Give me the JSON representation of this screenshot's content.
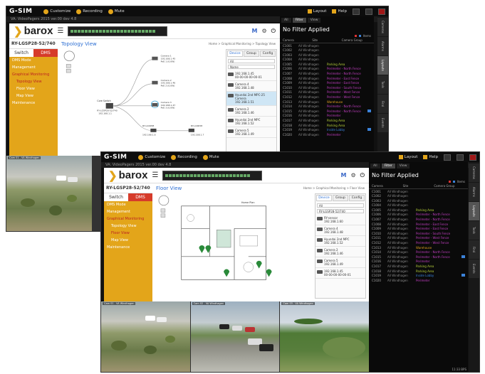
{
  "app": {
    "name": "G-SIM",
    "menu": [
      "Customize",
      "Recording",
      "Mute"
    ],
    "right_menu": [
      "Layout",
      "Help"
    ],
    "sub_label": "VA: VideoPagers 2015 ver.00 dev 4.8"
  },
  "brand": {
    "name": "barox"
  },
  "device": {
    "model": "RY-LGSP28-52/740"
  },
  "sidebar": {
    "tabs": [
      "Switch",
      "DMS"
    ],
    "items": [
      {
        "label": "DMS Mode"
      },
      {
        "label": "Management"
      },
      {
        "label": "Graphical Monitoring"
      },
      {
        "label": "Topology View"
      },
      {
        "label": "Floor View"
      },
      {
        "label": "Map View"
      },
      {
        "label": "Maintenance"
      }
    ]
  },
  "views": {
    "back": {
      "title": "Topology View",
      "crumb": "Home > Graphical Monitoring > Topology View"
    },
    "front": {
      "title": "Floor View",
      "crumb": "Home > Graphical Monitoring > Floor View",
      "floor_label": "Home Plan"
    }
  },
  "topology": {
    "core": {
      "label": "Core Switch",
      "model": "RY-LGSP28-52/740",
      "ip": "192.168.1.1"
    },
    "nodes": [
      {
        "name": "Camera 1",
        "ip": "192.168.1.45",
        "port": "PoE 1 (0.0W)"
      },
      {
        "name": "Camera 2",
        "ip": "192.168.1.46",
        "port": "PoE 2 (0.0W)"
      },
      {
        "name": "Camera 3",
        "ip": "192.168.1.47",
        "port": "PoE 3 (0.0W)"
      }
    ],
    "sw2": {
      "name": "RY-LGSP28",
      "ip": "192.168.1.6"
    },
    "sw3": {
      "name": "RY-LGSP28",
      "ip": "192.168.1.7"
    }
  },
  "device_panel": {
    "tabs": [
      "Device",
      "Group",
      "Config"
    ],
    "filter": "All",
    "select": "Name",
    "entries": [
      {
        "title": "192.168.1.45",
        "sub": "00-00-00-00-00-01"
      },
      {
        "title": "Camera 4",
        "sub": "192.168.1.48"
      },
      {
        "title": "Hyundai 2nd MPC-25 Camera",
        "sub": "192.168.1.51"
      },
      {
        "title": "Camera 2",
        "sub": "192.168.1.46"
      },
      {
        "title": "Hyundai 2nd MPC",
        "sub": "192.168.1.52"
      },
      {
        "title": "Camera 5",
        "sub": "192.168.1.49"
      },
      {
        "title": "RY-sensor",
        "sub": "192.168.1.60"
      }
    ]
  },
  "filter_panel": {
    "tabs": [
      "All",
      "Filter",
      "View"
    ],
    "title": "No Filter Applied",
    "count_label": "Items",
    "columns": [
      "Camera",
      "Site",
      "Camera Group"
    ],
    "rows": [
      {
        "id": "C1001",
        "site": "All Windhagen",
        "group": "",
        "color": "#cccccc",
        "flag": false
      },
      {
        "id": "C1002",
        "site": "All Windhagen",
        "group": "",
        "color": "#cccccc",
        "flag": false
      },
      {
        "id": "C1003",
        "site": "All Windhagen",
        "group": "",
        "color": "#cccccc",
        "flag": false
      },
      {
        "id": "C1004",
        "site": "All Windhagen",
        "group": "",
        "color": "#cccccc",
        "flag": false
      },
      {
        "id": "C1005",
        "site": "All Windhagen",
        "group": "Parking Area",
        "color": "#b8d23a",
        "flag": false
      },
      {
        "id": "C1006",
        "site": "All Windhagen",
        "group": "Perimeter - North Fence",
        "color": "#c23fc2",
        "flag": false
      },
      {
        "id": "C1007",
        "site": "All Windhagen",
        "group": "Perimeter - North Fence",
        "color": "#c23fc2",
        "flag": false
      },
      {
        "id": "C1008",
        "site": "All Windhagen",
        "group": "Perimeter - East Fence",
        "color": "#c23fc2",
        "flag": false
      },
      {
        "id": "C1009",
        "site": "All Windhagen",
        "group": "Perimeter - East Fence",
        "color": "#c23fc2",
        "flag": false
      },
      {
        "id": "C1010",
        "site": "All Windhagen",
        "group": "Perimeter - South Fence",
        "color": "#c23fc2",
        "flag": false
      },
      {
        "id": "C1011",
        "site": "All Windhagen",
        "group": "Perimeter - West Fence",
        "color": "#c23fc2",
        "flag": false
      },
      {
        "id": "C1012",
        "site": "All Windhagen",
        "group": "Perimeter - West Fence",
        "color": "#c23fc2",
        "flag": false
      },
      {
        "id": "C1013",
        "site": "All Windhagen",
        "group": "Warehouse",
        "color": "#e0a020",
        "flag": false
      },
      {
        "id": "C1014",
        "site": "All Windhagen",
        "group": "Perimeter - North Fence",
        "color": "#c23fc2",
        "flag": false
      },
      {
        "id": "C1015",
        "site": "All Windhagen",
        "group": "Perimeter - North Fence",
        "color": "#c23fc2",
        "flag": true
      },
      {
        "id": "C1016",
        "site": "All Windhagen",
        "group": "Perimeter",
        "color": "#c23fc2",
        "flag": false
      },
      {
        "id": "C1017",
        "site": "All Windhagen",
        "group": "Parking Area",
        "color": "#b8d23a",
        "flag": false
      },
      {
        "id": "C1018",
        "site": "All Windhagen",
        "group": "Parking Area",
        "color": "#b8d23a",
        "flag": false
      },
      {
        "id": "C1019",
        "site": "All Windhagen",
        "group": "Inside Lobby",
        "color": "#3b82d9",
        "flag": true
      },
      {
        "id": "C1020",
        "site": "All Windhagen",
        "group": "Perimeter",
        "color": "#c23fc2",
        "flag": false
      }
    ],
    "vtabs": [
      "Cameras",
      "Alarms",
      "Layouts",
      "Tools",
      "Find",
      "Events"
    ],
    "status": "11:33 BPS"
  },
  "camera_feeds": [
    {
      "label": "Cam 01 - VA Windhagen"
    },
    {
      "label": "Cam 02 - VA Windhagen"
    },
    {
      "label": "Cam 03 - VA Windhagen"
    }
  ],
  "colors": {
    "accent": "#e3a51a",
    "active_tab": "#d63b2a",
    "link_blue": "#2d6fd3"
  }
}
